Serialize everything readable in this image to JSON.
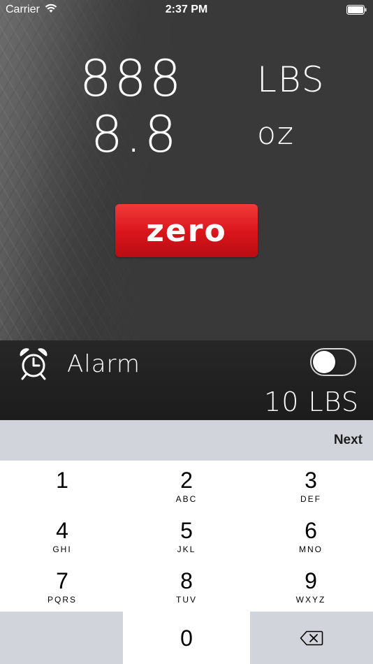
{
  "status_bar": {
    "carrier": "Carrier",
    "time": "2:37 PM",
    "wifi_icon": "wifi-icon",
    "battery_icon": "battery-icon"
  },
  "readout": {
    "pounds_value": "888",
    "pounds_unit": "LBS",
    "ounces_value": "8.8",
    "ounces_unit": "oz"
  },
  "zero_button": {
    "label": "zero",
    "color": "#d8141b"
  },
  "alarm": {
    "icon": "alarm-clock-icon",
    "label": "Alarm",
    "enabled": false,
    "threshold": "10 LBS"
  },
  "keyboard": {
    "accessory_button": "Next",
    "keys": [
      {
        "digit": "1",
        "letters": ""
      },
      {
        "digit": "2",
        "letters": "ABC"
      },
      {
        "digit": "3",
        "letters": "DEF"
      },
      {
        "digit": "4",
        "letters": "GHI"
      },
      {
        "digit": "5",
        "letters": "JKL"
      },
      {
        "digit": "6",
        "letters": "MNO"
      },
      {
        "digit": "7",
        "letters": "PQRS"
      },
      {
        "digit": "8",
        "letters": "TUV"
      },
      {
        "digit": "9",
        "letters": "WXYZ"
      },
      {
        "digit": "0",
        "letters": ""
      }
    ],
    "delete_icon": "backspace-icon"
  }
}
